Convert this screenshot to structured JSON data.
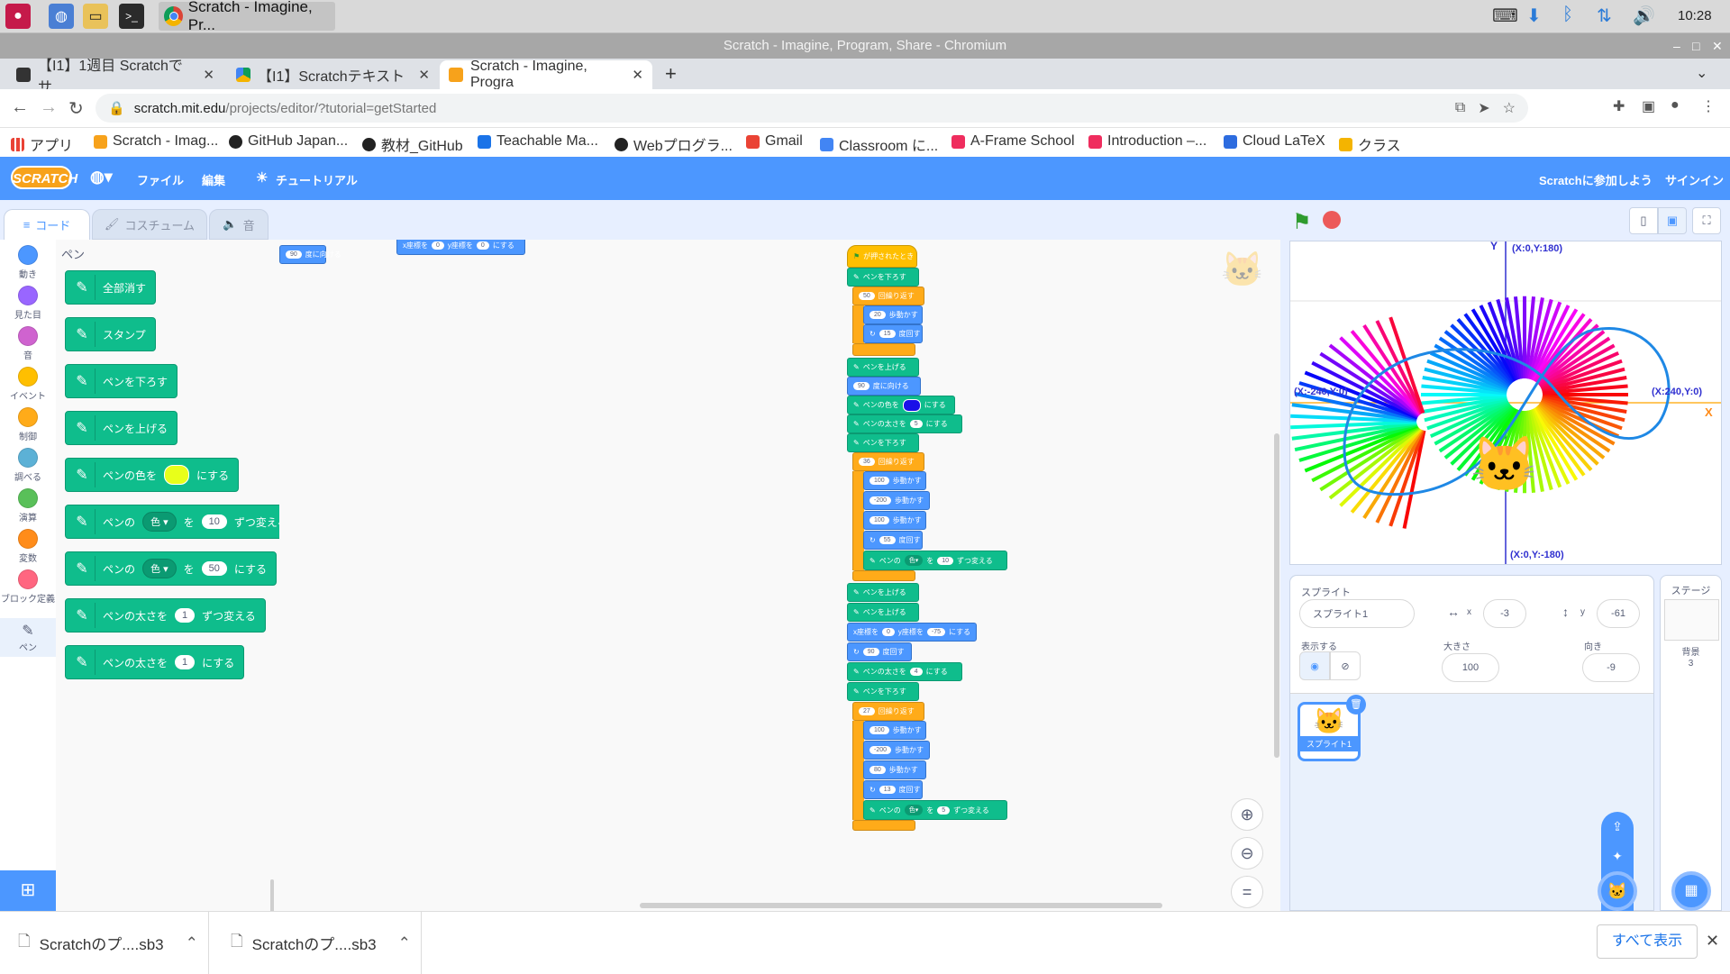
{
  "os": {
    "clock": "10:28",
    "taskbar_active_app": "Scratch - Imagine, Pr..."
  },
  "window": {
    "title": "Scratch - Imagine, Program, Share - Chromium"
  },
  "tabs": [
    {
      "label": "【I1】1週目 Scratchでサ"
    },
    {
      "label": "【I1】Scratchテキスト"
    },
    {
      "label": "Scratch - Imagine, Progra"
    }
  ],
  "address": {
    "domain": "scratch.mit.edu",
    "path": "/projects/editor/?tutorial=getStarted"
  },
  "bookmarks": [
    {
      "label": "アプリ",
      "color": "#e94235"
    },
    {
      "label": "Scratch - Imag...",
      "color": "#f7a21b"
    },
    {
      "label": "GitHub Japan...",
      "color": "#222222"
    },
    {
      "label": "教材_GitHub",
      "color": "#222222"
    },
    {
      "label": "Teachable Ma...",
      "color": "#1a73e8"
    },
    {
      "label": "Webプログラ...",
      "color": "#222222"
    },
    {
      "label": "Gmail",
      "color": "#ea4335"
    },
    {
      "label": "Classroom に...",
      "color": "#4285f4"
    },
    {
      "label": "A-Frame School",
      "color": "#ef2d5e"
    },
    {
      "label": "Introduction –...",
      "color": "#ef2d5e"
    },
    {
      "label": "Cloud LaTeX",
      "color": "#2d6cdf"
    },
    {
      "label": "クラス",
      "color": "#f4b400"
    }
  ],
  "scratch_menu": {
    "logo": "SCRATCH",
    "file": "ファイル",
    "edit": "編集",
    "tutorial": "チュートリアル",
    "join": "Scratchに参加しよう",
    "signin": "サインイン"
  },
  "editor_tabs": {
    "code": "コード",
    "costume": "コスチューム",
    "sound": "音"
  },
  "categories": [
    {
      "label": "動き",
      "color": "#4c97ff"
    },
    {
      "label": "見た目",
      "color": "#9966ff"
    },
    {
      "label": "音",
      "color": "#cf63cf"
    },
    {
      "label": "イベント",
      "color": "#ffbf00"
    },
    {
      "label": "制御",
      "color": "#ffab19"
    },
    {
      "label": "調べる",
      "color": "#5cb1d6"
    },
    {
      "label": "演算",
      "color": "#59c059"
    },
    {
      "label": "変数",
      "color": "#ff8c1a"
    },
    {
      "label": "ブロック定義",
      "color": "#ff6680"
    },
    {
      "label": "ペン",
      "color": "#0fbd8c"
    }
  ],
  "palette": {
    "heading": "ペン",
    "blocks": {
      "clear": "全部消す",
      "stamp": "スタンプ",
      "pen_down": "ペンを下ろす",
      "pen_up": "ペンを上げる",
      "set_color_pre": "ペンの色を",
      "set_color_post": "にする",
      "change_param_pre": "ペンの",
      "change_param_dd": "色",
      "change_param_mid": "を",
      "change_param_val": "10",
      "change_param_post": "ずつ変える",
      "set_param_pre": "ペンの",
      "set_param_dd": "色",
      "set_param_mid": "を",
      "set_param_val": "50",
      "set_param_post": "にする",
      "change_size_pre": "ペンの太さを",
      "change_size_val": "1",
      "change_size_post": "ずつ変える",
      "set_size_pre": "ペンの太さを",
      "set_size_val": "1",
      "set_size_post": "にする"
    }
  },
  "script": {
    "green_flag": "が押されたとき",
    "pen_down": "ペンを下ろす",
    "pen_up": "ペンを上げる",
    "repeat": "回繰り返す",
    "move": "歩動かす",
    "turn": "度回す",
    "point_dir": "度に向ける",
    "set_color": "ペンの色を",
    "set_to": "にする",
    "set_size": "ペンの太さを",
    "change_pre": "ペンの",
    "color_dd": "色",
    "change_mid": "を",
    "change_post": "ずつ変える",
    "goto_x": "x座標を",
    "goto_y": "y座標を",
    "values": {
      "r1": "50",
      "m1": "20",
      "t1": "15",
      "dir1": "90",
      "size1": "5",
      "r2": "36",
      "m2a": "100",
      "m2b": "-200",
      "m2c": "100",
      "t2": "55",
      "c2": "10",
      "gx": "0",
      "gy": "-75",
      "dir2": "90",
      "size2": "4",
      "r3": "27",
      "m3a": "100",
      "m3b": "-200",
      "m3c": "80",
      "t3": "13",
      "c3": "5",
      "top_dir": "90",
      "top_x": "0",
      "top_y": "0"
    }
  },
  "stage": {
    "axis_y": "Y",
    "axis_x": "X",
    "top_label": "(X:0,Y:180)",
    "left_label": "(X:-240,Y:0)",
    "right_label": "(X:240,Y:0)",
    "bottom_label": "(X:0,Y:-180)"
  },
  "sprite_info": {
    "sprite_label": "スプライト",
    "name": "スプライト1",
    "x_label": "x",
    "x": "-3",
    "y_label": "y",
    "y": "-61",
    "show_label": "表示する",
    "size_label": "大きさ",
    "size": "100",
    "direction_label": "向き",
    "direction": "-9",
    "thumb_label": "スプライト1"
  },
  "stage_panel": {
    "title": "ステージ",
    "backdrop_label": "背景",
    "backdrop_count": "3"
  },
  "downloads": [
    {
      "name": "Scratchのプ....sb3"
    },
    {
      "name": "Scratchのプ....sb3"
    }
  ],
  "downloads_show_all": "すべて表示"
}
